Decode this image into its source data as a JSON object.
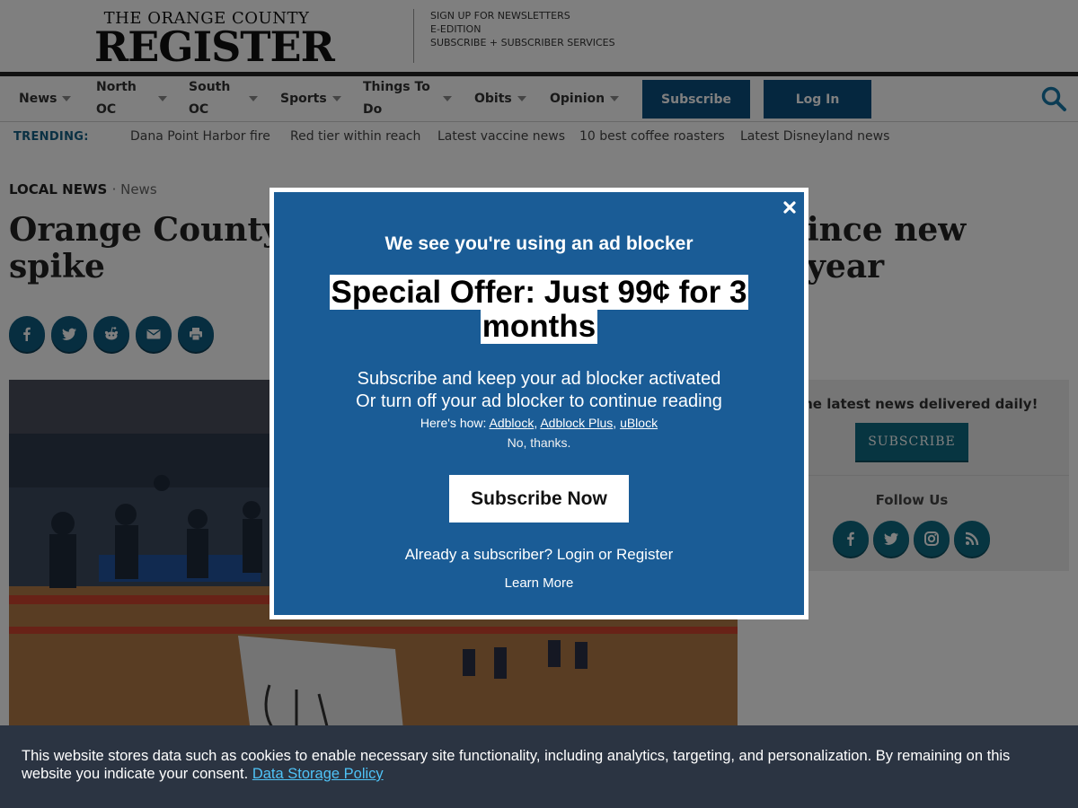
{
  "header": {
    "logo_top": "THE ORANGE COUNTY",
    "logo_main": "REGISTER",
    "links": [
      "SIGN UP FOR NEWSLETTERS",
      "E-EDITION",
      "SUBSCRIBE + SUBSCRIBER SERVICES"
    ]
  },
  "nav": {
    "items": [
      {
        "line1": "News",
        "line2": ""
      },
      {
        "line1": "North",
        "line2": "OC"
      },
      {
        "line1": "South",
        "line2": "OC"
      },
      {
        "line1": "Sports",
        "line2": ""
      },
      {
        "line1": "Things To",
        "line2": "Do"
      },
      {
        "line1": "Obits",
        "line2": ""
      },
      {
        "line1": "Opinion",
        "line2": ""
      }
    ],
    "subscribe_label": "Subscribe",
    "login_label": "Log In"
  },
  "trending": {
    "label": "TRENDING:",
    "links": [
      "Dana Point Harbor fire",
      "Red tier within reach",
      "Latest vaccine news",
      "10 best coffee roasters",
      "Latest Disneyland news"
    ]
  },
  "article": {
    "kicker": "LOCAL NEWS",
    "kicker_sub": "· News",
    "headline_left": "Orange County’s",
    "headline_right": "ince new year",
    "headline_line2": "spike"
  },
  "sidebar": {
    "news_text": "t the latest news delivered daily!",
    "subscribe_label": "SUBSCRIBE",
    "follow_label": "Follow Us"
  },
  "modal": {
    "heading": "We see you're using an ad blocker",
    "offer": "Special Offer: Just 99¢ for 3 months",
    "msg_line1": "Subscribe and keep your ad blocker activated",
    "msg_line2": "Or turn off your ad blocker to continue reading",
    "howto_prefix": "Here's how: ",
    "howto_links": [
      "Adblock",
      "Adblock Plus",
      "uBlock"
    ],
    "no_thanks": "No, thanks.",
    "subscribe_now": "Subscribe Now",
    "already": "Already a subscriber? Login or Register",
    "learn_more": "Learn More"
  },
  "cookie": {
    "text": "This website stores data such as cookies to enable necessary site functionality, including analytics, targeting, and personalization. By remaining on this website you indicate your consent.",
    "link": "Data Storage Policy"
  },
  "colors": {
    "brand_blue": "#0b4f7f",
    "modal_blue": "#1a5c96",
    "teal": "#0f6b82",
    "cookie_bg": "#2b3442",
    "cookie_link": "#4fc3f7"
  }
}
